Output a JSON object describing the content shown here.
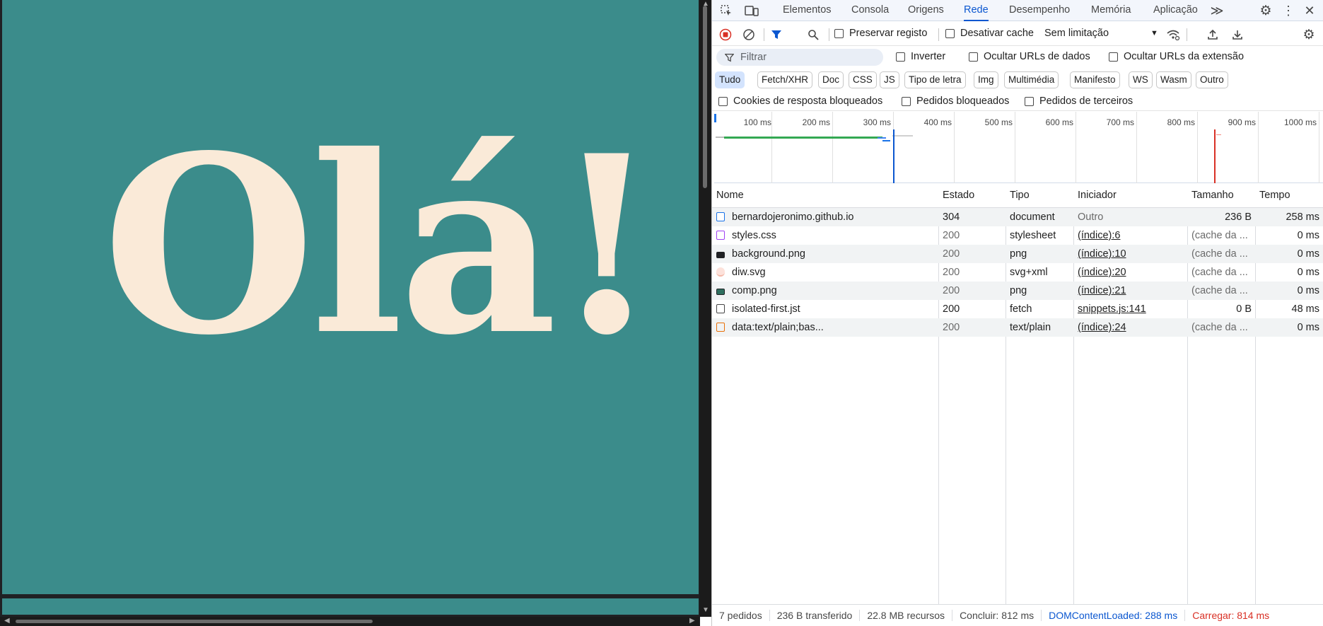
{
  "page": {
    "greeting": "Olá!"
  },
  "devtools": {
    "tabs": [
      {
        "label": "Elementos"
      },
      {
        "label": "Consola"
      },
      {
        "label": "Origens"
      },
      {
        "label": "Rede",
        "active": true
      },
      {
        "label": "Desempenho"
      },
      {
        "label": "Memória"
      },
      {
        "label": "Aplicação"
      }
    ],
    "more_tabs_glyph": "≫",
    "toolbar": {
      "preserve_log": "Preservar registo",
      "disable_cache": "Desativar cache",
      "throttling": "Sem limitação"
    },
    "filter": {
      "placeholder": "Filtrar",
      "invert": "Inverter",
      "hide_data_urls": "Ocultar URLs de dados",
      "hide_extension_urls": "Ocultar URLs da extensão"
    },
    "type_filters": [
      "Tudo",
      "Fetch/XHR",
      "Doc",
      "CSS",
      "JS",
      "Tipo de letra",
      "Img",
      "Multimédia",
      "Manifesto",
      "WS",
      "Wasm",
      "Outro"
    ],
    "extra_filters": {
      "blocked_cookies": "Cookies de resposta bloqueados",
      "blocked_requests": "Pedidos bloqueados",
      "third_party": "Pedidos de terceiros"
    },
    "timeline_labels": [
      "100 ms",
      "200 ms",
      "300 ms",
      "400 ms",
      "500 ms",
      "600 ms",
      "700 ms",
      "800 ms",
      "900 ms",
      "1000 ms"
    ],
    "columns": {
      "name": "Nome",
      "status": "Estado",
      "type": "Tipo",
      "initiator": "Iniciador",
      "size": "Tamanho",
      "time": "Tempo"
    },
    "requests": [
      {
        "name": "bernardojeronimo.github.io",
        "icon": "document-icon",
        "status": "304",
        "type": "document",
        "initiator": "Outro",
        "size": "236 B",
        "time": "258 ms"
      },
      {
        "name": "styles.css",
        "icon": "stylesheet-icon",
        "status": "200",
        "type": "stylesheet",
        "initiator": "(índice):6",
        "size": "(cache da ...",
        "time": "0 ms"
      },
      {
        "name": "background.png",
        "icon": "image-icon",
        "status": "200",
        "type": "png",
        "initiator": "(índice):10",
        "size": "(cache da ...",
        "time": "0 ms"
      },
      {
        "name": "diw.svg",
        "icon": "svg-icon",
        "status": "200",
        "type": "svg+xml",
        "initiator": "(índice):20",
        "size": "(cache da ...",
        "time": "0 ms"
      },
      {
        "name": "comp.png",
        "icon": "image-icon",
        "status": "200",
        "type": "png",
        "initiator": "(índice):21",
        "size": "(cache da ...",
        "time": "0 ms"
      },
      {
        "name": "isolated-first.jst",
        "icon": "file-icon",
        "status": "200",
        "type": "fetch",
        "initiator": "snippets.js:141",
        "size": "0 B",
        "time": "48 ms"
      },
      {
        "name": "data:text/plain;bas...",
        "icon": "data-icon",
        "status": "200",
        "type": "text/plain",
        "initiator": "(índice):24",
        "size": "(cache da ...",
        "time": "0 ms"
      }
    ],
    "status_bar": {
      "requests": "7 pedidos",
      "transferred": "236 B transferido",
      "resources": "22.8 MB recursos",
      "finish": "Concluir: 812 ms",
      "dom_loaded": "DOMContentLoaded: 288 ms",
      "load": "Carregar: 814 ms"
    },
    "colors": {
      "accent": "#0b57d0",
      "load_red": "#d93025",
      "page_bg": "#3b8c8b",
      "greeting": "#faead8"
    }
  }
}
